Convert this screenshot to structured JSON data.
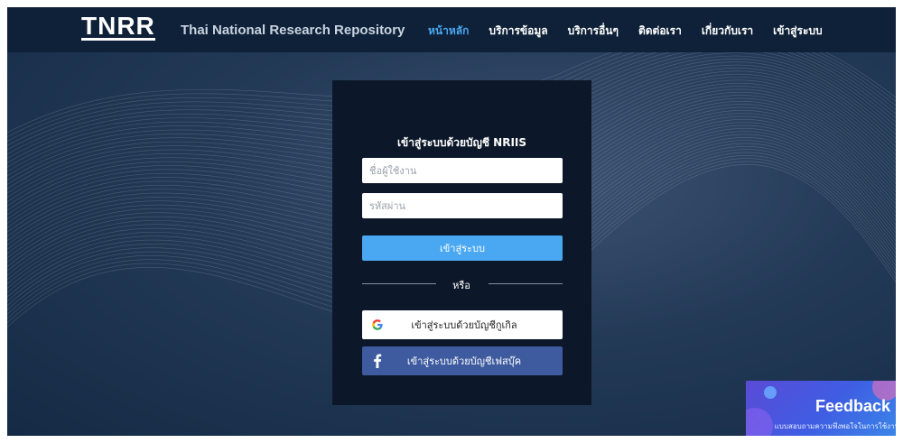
{
  "header": {
    "logo": "TNRR",
    "site_name": "Thai National Research Repository",
    "menu": [
      {
        "label": "หน้าหลัก",
        "active": true
      },
      {
        "label": "บริการข้อมูล",
        "active": false
      },
      {
        "label": "บริการอื่นๆ",
        "active": false
      },
      {
        "label": "ติดต่อเรา",
        "active": false
      },
      {
        "label": "เกี่ยวกับเรา",
        "active": false
      },
      {
        "label": "เข้าสู่ระบบ",
        "active": false
      }
    ]
  },
  "login": {
    "title": "เข้าสู่ระบบด้วยบัญชี NRIIS",
    "username_placeholder": "ชื่อผู้ใช้งาน",
    "password_placeholder": "รหัสผ่าน",
    "submit_label": "เข้าสู่ระบบ",
    "divider": "หรือ",
    "google_label": "เข้าสู่ระบบด้วยบัญชีกูเกิล",
    "facebook_label": "เข้าสู่ระบบด้วยบัญชีเฟสบุ๊ค"
  },
  "feedback": {
    "title": "Feedback",
    "subtitle": "แบบสอบถามความพึงพอใจในการใช้งาน"
  },
  "icons": {
    "google": "google-icon",
    "facebook": "facebook-icon"
  },
  "colors": {
    "accent": "#4aa8f2",
    "navbar": "#0f2138",
    "card": "#0c1829",
    "facebook": "#3e5ba0"
  }
}
